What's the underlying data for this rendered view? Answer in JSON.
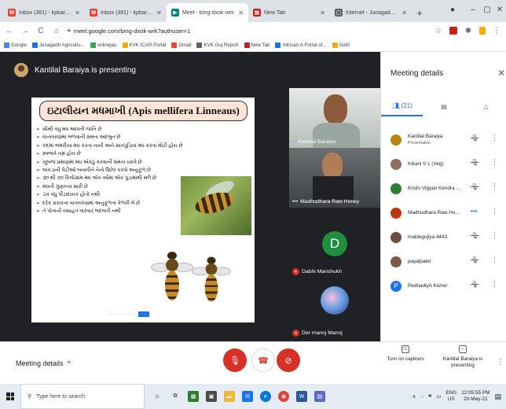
{
  "browser": {
    "tabs": [
      {
        "title": "Inbox (381) - kpbaraiya@gm",
        "icon": "gmail-icon",
        "color": "#ea4335",
        "glyph": "M",
        "active": false
      },
      {
        "title": "Inbox (381) - kpbaraiya@gm",
        "icon": "gmail-icon",
        "color": "#ea4335",
        "glyph": "M",
        "active": false
      },
      {
        "title": "Meet - bmg-dxok-wrk",
        "icon": "meet-icon",
        "color": "#00897b",
        "glyph": "▶",
        "active": true
      },
      {
        "title": "New Tab",
        "icon": "newtab-icon",
        "color": "#c5221f",
        "glyph": "▦",
        "active": false
      },
      {
        "title": "Internet - Junagadh Agricult",
        "icon": "page-icon",
        "color": "#5f6368",
        "glyph": "▢",
        "active": false
      }
    ],
    "url": "meet.google.com/bmg-dxok-wrk?authuser=1",
    "bookmarks": [
      {
        "label": "Google",
        "color": "#4285f4"
      },
      {
        "label": "Junagadh Agricultu...",
        "color": "#1a73e8"
      },
      {
        "label": "onlinejau",
        "color": "#34a853"
      },
      {
        "label": "KVK ICAR Portal",
        "color": "#f9ab00"
      },
      {
        "label": "Gmail",
        "color": "#ea4335"
      },
      {
        "label": "KVK Guj Report",
        "color": "#5f6368"
      },
      {
        "label": "New Tab",
        "color": "#c5221f"
      },
      {
        "label": "mKisan:A Portal of...",
        "color": "#1a73e8"
      },
      {
        "label": "GeM",
        "color": "#f9ab00"
      }
    ]
  },
  "meet": {
    "presenter_banner": "Kantilal Baraiya is presenting",
    "slide": {
      "title": "ઇટાલીયન મધમાખી (Apis mellifera Linneaus)",
      "bullets": [
        "સૌથી વધુ મધ આપતી જાતિ છે",
        "વાતાવરણમાં ભળવાની ક્ષમતા અદભુત છે",
        "કદમાં ભમરીયા મધ કરતા નાની અને સાતપુડિયા મધ કરતા મોટી હોય છે",
        "સ્વભાવે નમ્ર હોય છે",
        "ખૂબજ પ્રમાણમાં મધ એકઠું કરવાની ક્ષમતા ધરાવે છે",
        "લાકડાની પેટીઓ બનાવીને તેનો ઉછેર કરવો અનુકૂળ છે",
        "૩૦ થી ૭૦ કિલોગ્રામ મધ એક વર્ષમાં એક પુડામાંથી મળે છે",
        "મધની ગુણવત્તા સારી છે",
        "ડંખ વધુ પીડાદાયક હોતો નથી",
        "દરેક પ્રકારના વાતાવરણમાં અનુકૂળતા કેળવી લે છે",
        "તે પોતાની વસાહત વારંવાર બદલતી નથી"
      ]
    },
    "tiles": [
      {
        "name": "Kantilal Baraiya",
        "kind": "video"
      },
      {
        "name": "Madhudhara Raw Honey",
        "kind": "video"
      },
      {
        "name": "Dabhi Manshukh",
        "kind": "letter",
        "letter": "D"
      },
      {
        "name": "Der manoj Manoj",
        "kind": "image"
      }
    ],
    "bottom": {
      "meeting_details": "Meeting details",
      "captions_label": "Turn on captions",
      "presenting_label": "Kantilal Baraiya is presenting"
    }
  },
  "panel": {
    "title": "Meeting details",
    "people_count": "(21)",
    "participants": [
      {
        "name": "Kantilal Baraiya",
        "sub": "Presentation",
        "avatar": "emblem",
        "color": "#b8860b"
      },
      {
        "name": "Kikani V L (Veg)",
        "sub": "",
        "avatar": "photo",
        "color": "#8d6e63"
      },
      {
        "name": "Krishi Vigyan Kendra Ja...",
        "sub": "",
        "avatar": "logo",
        "color": "#2e7d32"
      },
      {
        "name": "Madhudhara Raw Honey",
        "sub": "",
        "avatar": "photo",
        "color": "#bf360c"
      },
      {
        "name": "maldegojiya 4443",
        "sub": "",
        "avatar": "photo",
        "color": "#6d4c41"
      },
      {
        "name": "payalpatel",
        "sub": "",
        "avatar": "photo",
        "color": "#7b5a4a"
      },
      {
        "name": "PedhadiyA Kishor",
        "sub": "",
        "avatar": "letter",
        "letter": "P",
        "color": "#1a73e8"
      }
    ]
  },
  "taskbar": {
    "search_placeholder": "Type here to search",
    "lang": "ENG",
    "region": "US",
    "time": "12:05:55 PM",
    "date": "20-May-21"
  }
}
